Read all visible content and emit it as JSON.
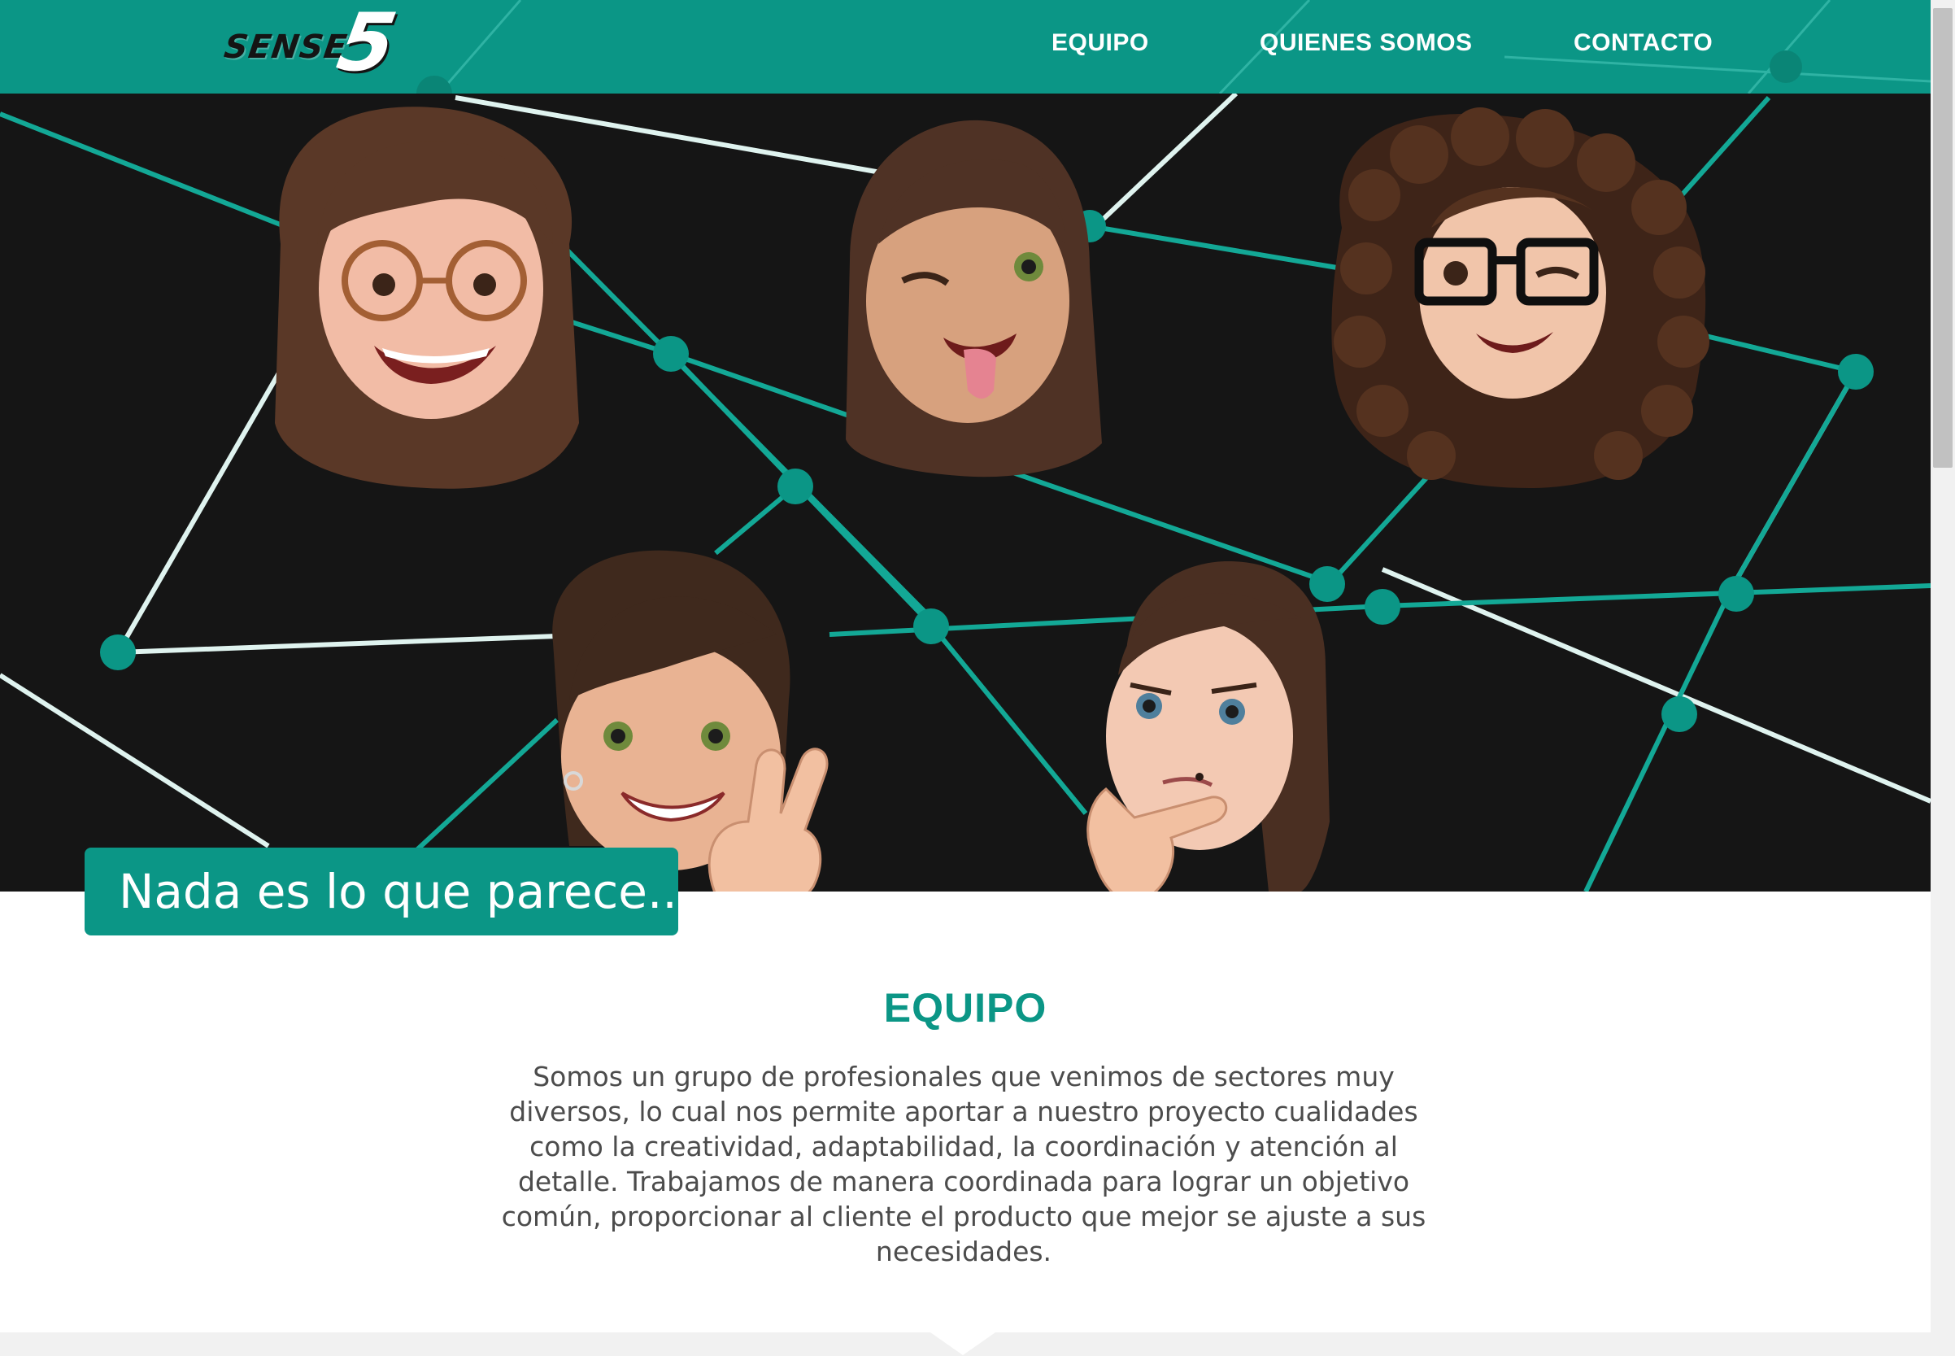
{
  "header": {
    "logo_word": "SENSE",
    "logo_number": "5",
    "nav": [
      {
        "label": "EQUIPO"
      },
      {
        "label": "QUIENES SOMOS"
      },
      {
        "label": "CONTACTO"
      }
    ]
  },
  "hero": {
    "tagline": "Nada es lo que parece..."
  },
  "team_section": {
    "title": "EQUIPO",
    "text": "Somos un grupo de profesionales que venimos de sectores muy diversos, lo cual nos permite aportar a nuestro proyecto cualidades como la creatividad, adaptabilidad, la coordinación y atención al detalle. Trabajamos de manera coordinada para lograr un objetivo común, proporcionar al cliente el producto que mejor se ajuste a sus necesidades."
  },
  "theme": {
    "brand": "#0b9686",
    "hero_bg": "#151515",
    "text": "#4c4c4c"
  }
}
